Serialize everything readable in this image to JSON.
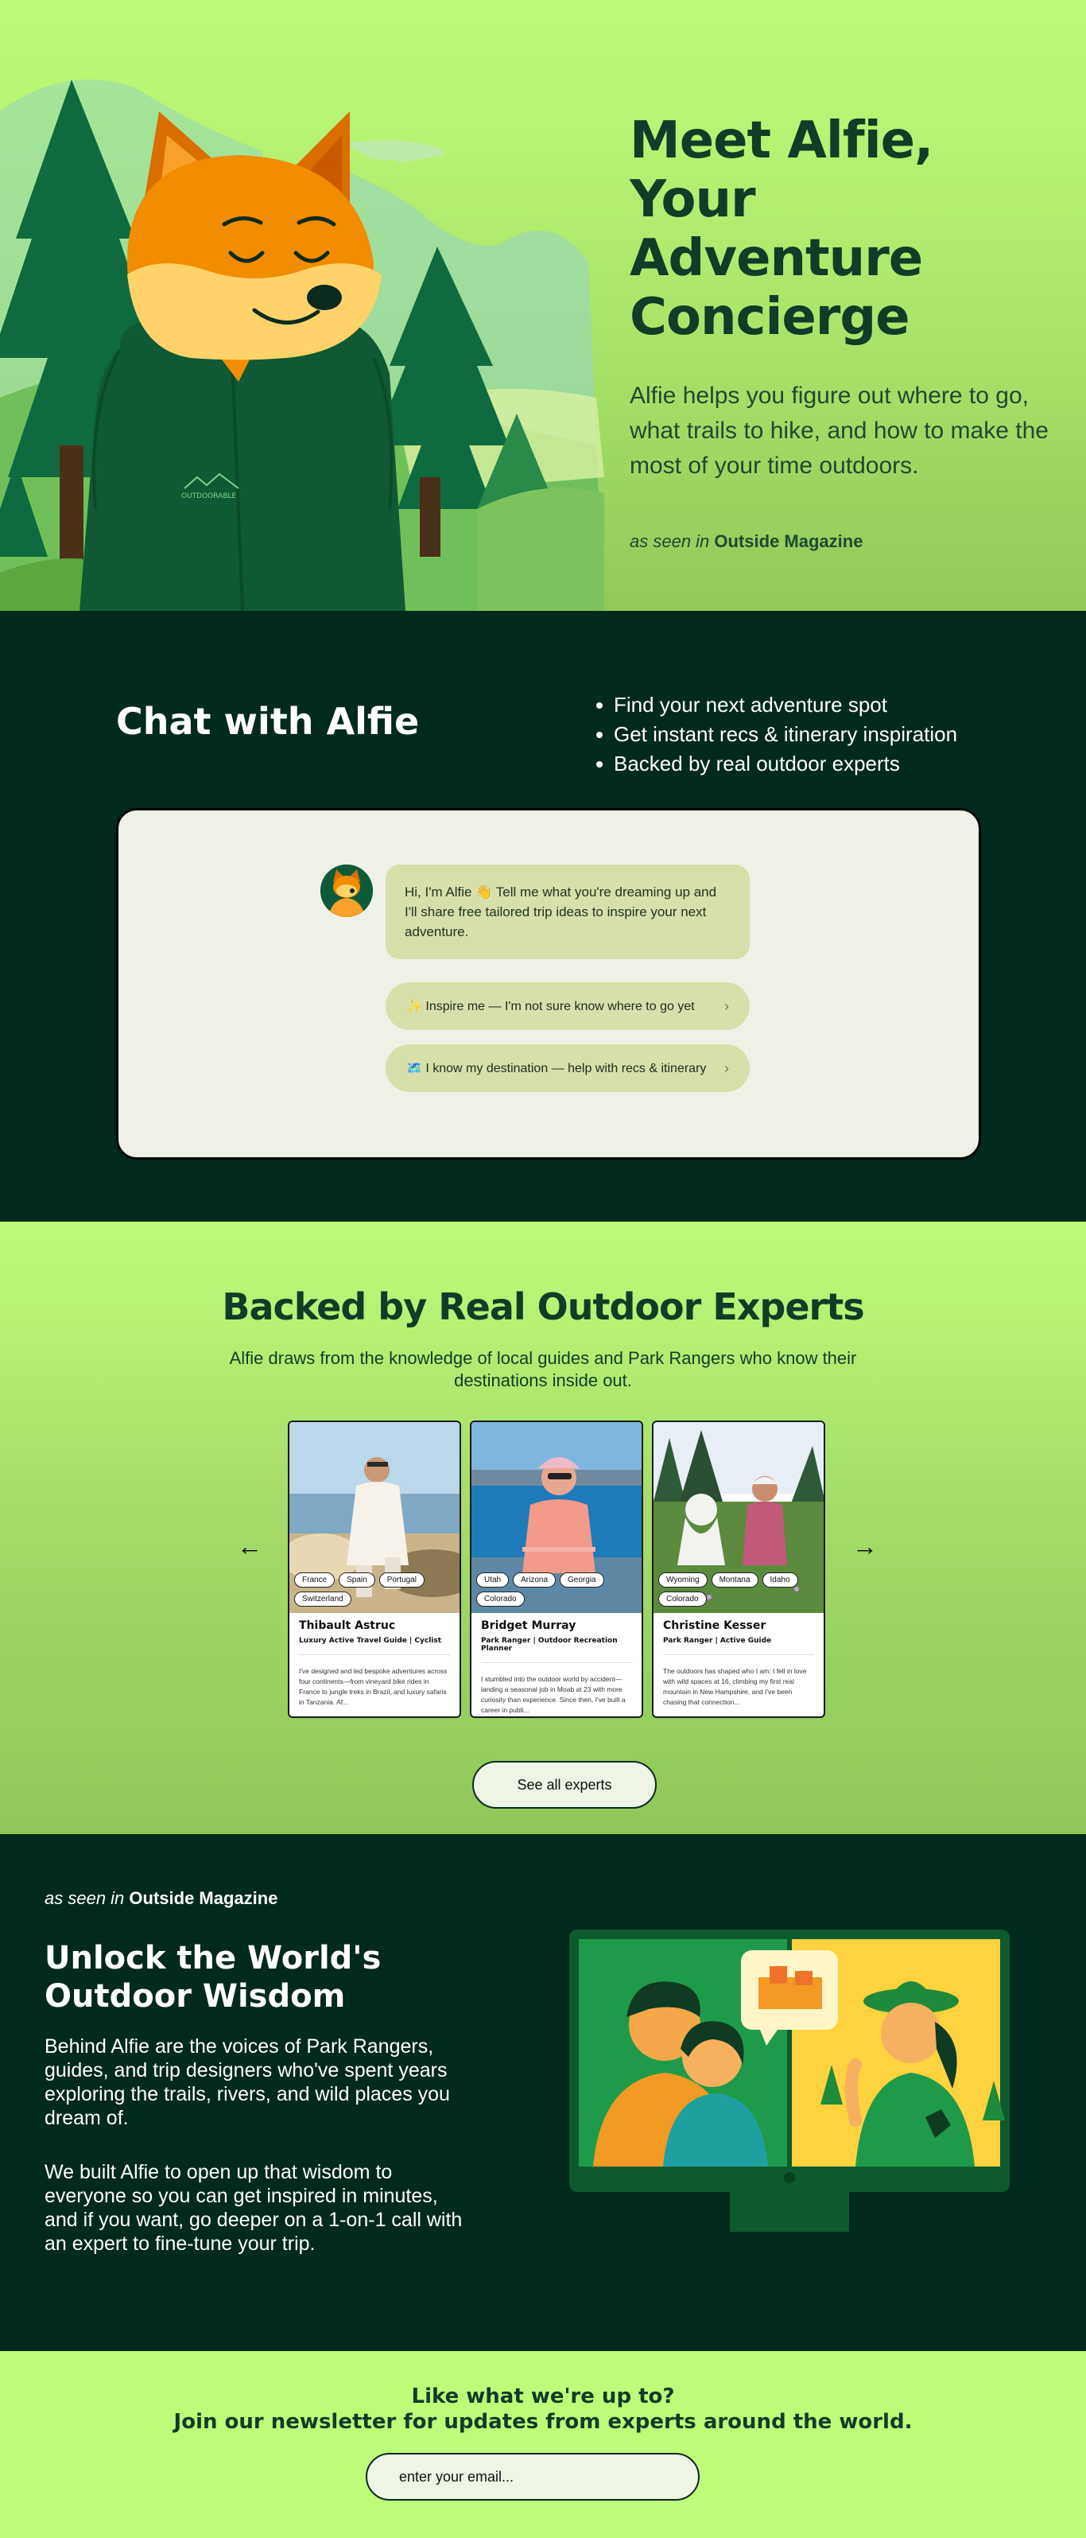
{
  "hero": {
    "title_line1": "Meet Alfie,",
    "title_line2": "Your Adventure",
    "title_line3": "Concierge",
    "subtitle": "Alfie helps you figure out where to go, what trails to hike, and how to make the most of your time outdoors.",
    "seen_prefix": "as seen in",
    "seen_brand": "Outside Magazine",
    "jacket_logo": "OUTDOORABLE"
  },
  "chat": {
    "title": "Chat with Alfie",
    "bullets": [
      "Find your next adventure spot",
      "Get instant recs & itinerary inspiration",
      "Backed by real outdoor experts"
    ],
    "greeting": "Hi, I'm Alfie 👋 Tell me what you're dreaming up and I'll share free tailored trip ideas to inspire your next adventure.",
    "option1": "✨ Inspire me — I'm not sure know where to go yet",
    "option2": "🗺️ I know my destination — help with recs & itinerary",
    "chevron": "›"
  },
  "experts": {
    "title": "Backed by Real Outdoor Experts",
    "subtitle": "Alfie draws from the knowledge of local guides and  Park Rangers who know their destinations inside out.",
    "arrow_left": "←",
    "arrow_right": "→",
    "cards": [
      {
        "tags": [
          "France",
          "Spain",
          "Portugal",
          "Switzerland"
        ],
        "name": "Thibault Astruc",
        "role": "Luxury Active Travel Guide | Cyclist",
        "bio": "I've designed and led bespoke adventures across four continents—from vineyard bike rides in France to jungle treks in Brazil, and luxury safaris in Tanzania. Af..."
      },
      {
        "tags": [
          "Utah",
          "Arizona",
          "Georgia",
          "Colorado"
        ],
        "name": "Bridget Murray",
        "role": "Park Ranger | Outdoor Recreation Planner",
        "bio": "I stumbled into the outdoor world by accident—landing a seasonal job in Moab at 23 with more curiosity than experience. Since then, I've built a career in publi..."
      },
      {
        "tags": [
          "Wyoming",
          "Montana",
          "Idaho",
          "Colorado"
        ],
        "name": "Christine Kesser",
        "role": "Park Ranger | Active Guide",
        "bio": "The outdoors has shaped who I am: I fell in love with wild spaces at 16, climbing my first real mountain in New Hampshire, and I've been chasing that connection..."
      }
    ],
    "see_all": "See all experts"
  },
  "wisdom": {
    "seen_prefix": "as seen in",
    "seen_brand": "Outside Magazine",
    "title": "Unlock the World's Outdoor Wisdom",
    "p1": "Behind Alfie are the voices of Park Rangers, guides, and trip designers who've spent years exploring the trails, rivers, and wild places you dream of.",
    "p2": "We built Alfie to open up that wisdom to everyone so you can get inspired in minutes, and if you want, go deeper on a 1-on-1 call with an expert to fine-tune your trip."
  },
  "newsletter": {
    "line1": "Like what we're up to?",
    "line2": "Join our newsletter for updates from experts around the world.",
    "placeholder": "enter your email..."
  },
  "colors": {
    "lime": "#bdfd7a",
    "dark_green": "#002a1c",
    "heading_green": "#0f3d27",
    "fox_orange": "#f28c00"
  }
}
